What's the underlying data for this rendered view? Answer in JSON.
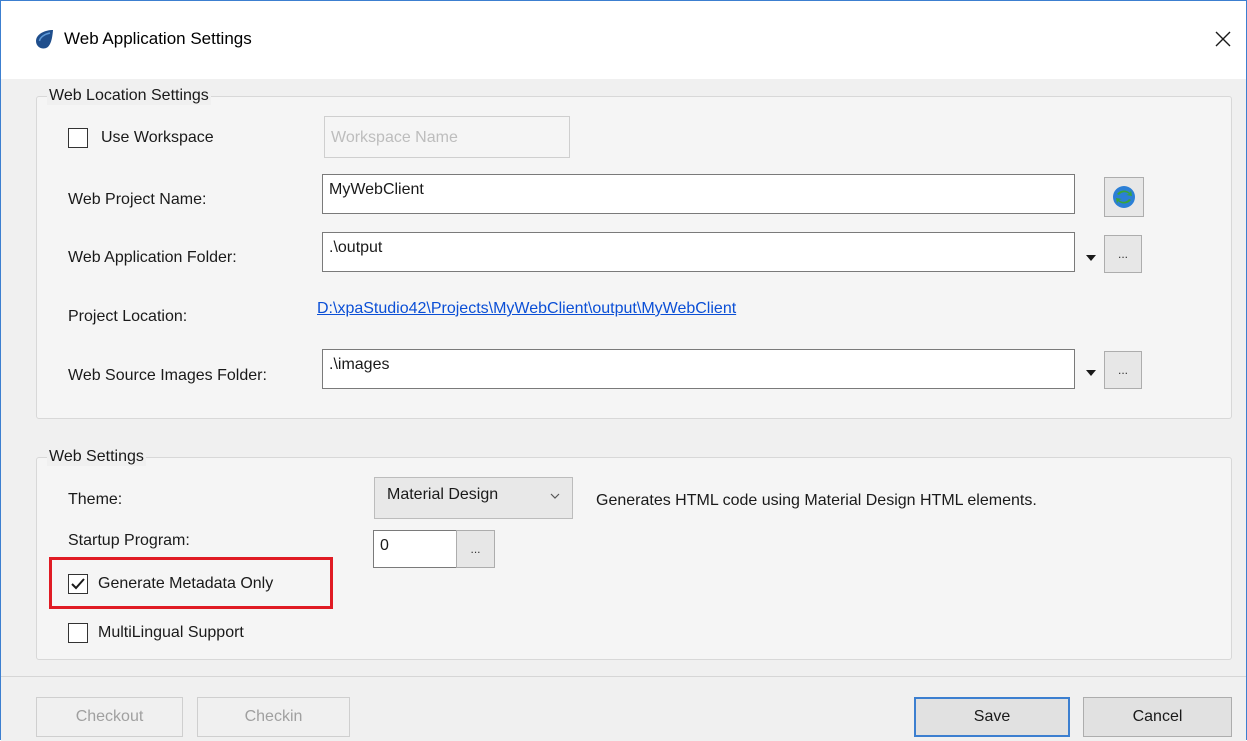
{
  "window": {
    "title": "Web Application Settings"
  },
  "icons": {
    "app": "water-drop-icon",
    "close": "close-icon",
    "refresh": "refresh-globe-icon",
    "browse": "ellipsis-icon",
    "dropdown": "caret-down-icon",
    "check": "checkmark-icon"
  },
  "web_location": {
    "caption": "Web Location Settings",
    "use_workspace_label": "Use Workspace",
    "use_workspace_checked": false,
    "workspace_placeholder": "Workspace Name",
    "project_name_label": "Web Project Name:",
    "project_name_value": "MyWebClient",
    "app_folder_label": "Web Application Folder:",
    "app_folder_value": ".\\output",
    "project_location_label": "Project Location:",
    "project_location_link": "D:\\xpaStudio42\\Projects\\MyWebClient\\output\\MyWebClient",
    "images_folder_label": "Web Source Images Folder:",
    "images_folder_value": ".\\images",
    "browse_label": "..."
  },
  "web_settings": {
    "caption": "Web Settings",
    "theme_label": "Theme:",
    "theme_value": "Material Design",
    "theme_description": "Generates HTML code using Material Design HTML elements.",
    "startup_label": "Startup Program:",
    "startup_value": "0",
    "browse_label": "...",
    "metadata_label": "Generate Metadata Only",
    "metadata_checked": true,
    "multilingual_label": "MultiLingual Support",
    "multilingual_checked": false
  },
  "footer": {
    "checkout": "Checkout",
    "checkin": "Checkin",
    "save": "Save",
    "cancel": "Cancel"
  },
  "colors": {
    "accent": "#3c7fd0",
    "link": "#0b4fd6",
    "highlight": "#e01b24"
  }
}
